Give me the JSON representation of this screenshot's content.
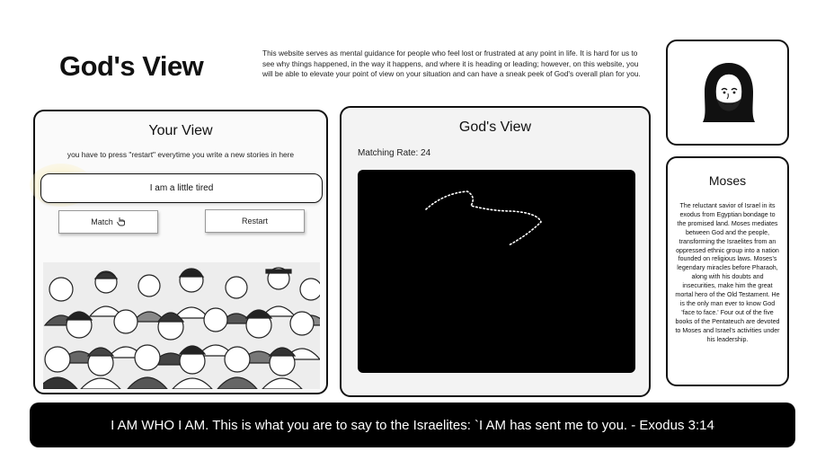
{
  "header": {
    "title": "God's View",
    "intro": "This website serves as mental guidance for people who feel lost or frustrated at any point in life. It is hard for us to see why things happened, in the way it happens, and where it is heading or leading; however, on this website, you will be able to elevate your point of view on your situation and can have a sneak peek of God's overall plan for you."
  },
  "your_view": {
    "title": "Your View",
    "hint": "you have to press \"restart\" everytime you write a new stories in here",
    "input_value": "I am a little tired",
    "match_label": "Match",
    "restart_label": "Restart",
    "crowd_icon": "crowd-illustration"
  },
  "gods_view": {
    "title": "God's View",
    "matching_rate": "Matching Rate: 24",
    "path_color": "#ffffff"
  },
  "character": {
    "avatar_icon": "hooded-bearded-man-icon",
    "name": "Moses",
    "bio": "The reluctant savior of Israel in its exodus from Egyptian bondage to the promised land. Moses mediates between God and the people, transforming the Israelites from an oppressed ethnic group into a nation founded on religious laws. Moses's legendary miracles before Pharaoh, along with his doubts and insecurities, make him the great mortal hero of the Old Testament. He is the only man ever to know God 'face to face.' Four out of the five books of the Pentateuch are devoted to Moses and Israel's activities under his leadership."
  },
  "footer": {
    "verse": "I AM WHO I AM. This is what you are to say to the Israelites: `I AM has sent me to you. - Exodus 3:14"
  }
}
